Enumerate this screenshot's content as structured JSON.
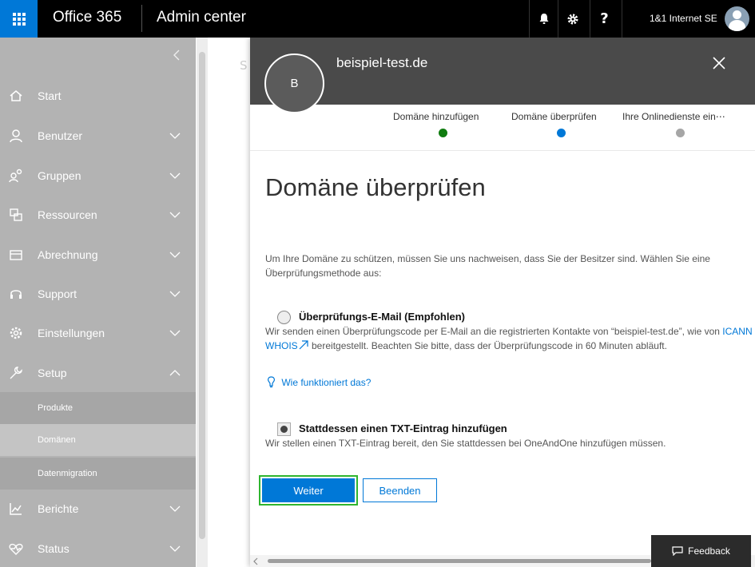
{
  "topbar": {
    "brand": "Office 365",
    "app_title": "Admin center",
    "user_name": "1&1 Internet SE",
    "help_label": "?"
  },
  "sidebar": {
    "items": [
      {
        "label": "Start",
        "icon": "home-icon"
      },
      {
        "label": "Benutzer",
        "icon": "user-icon"
      },
      {
        "label": "Gruppen",
        "icon": "group-icon"
      },
      {
        "label": "Ressourcen",
        "icon": "resources-icon"
      },
      {
        "label": "Abrechnung",
        "icon": "billing-icon"
      },
      {
        "label": "Support",
        "icon": "headset-icon"
      },
      {
        "label": "Einstellungen",
        "icon": "gear-icon"
      },
      {
        "label": "Setup",
        "icon": "wrench-icon"
      },
      {
        "label": "Berichte",
        "icon": "chart-icon"
      },
      {
        "label": "Status",
        "icon": "heart-icon"
      }
    ],
    "setup_sub": [
      {
        "label": "Produkte"
      },
      {
        "label": "Domänen",
        "active": true
      },
      {
        "label": "Datenmigration"
      }
    ]
  },
  "background": {
    "ghost_text": "S"
  },
  "panel": {
    "avatar_letter": "B",
    "title": "beispiel-test.de",
    "steps": [
      {
        "label": "Domäne hinzufügen",
        "state": "done"
      },
      {
        "label": "Domäne überprüfen",
        "state": "current"
      },
      {
        "label": "Ihre Onlinedienste ein⋯",
        "state": "future"
      }
    ],
    "heading": "Domäne überprüfen",
    "intro": "Um Ihre Domäne zu schützen, müssen Sie uns nachweisen, dass Sie der Besitzer sind. Wählen Sie eine Überprüfungsmethode aus:",
    "option_email": {
      "title": "Überprüfungs-E-Mail (Empfohlen)",
      "desc_part1": "Wir senden einen Überprüfungscode per E-Mail an die registrierten Kontakte von “beispiel-test.de”, wie von ",
      "link": "ICANN WHOIS",
      "desc_part2": " bereitgestellt. Beachten Sie bitte, dass der Überprüfungscode in 60 Minuten abläuft.",
      "selected": false
    },
    "help_link": "Wie funktioniert das?",
    "option_txt": {
      "title": "Stattdessen einen TXT-Eintrag hinzufügen",
      "desc": "Wir stellen einen TXT-Eintrag bereit, den Sie stattdessen bei OneAndOne hinzufügen müssen.",
      "selected": true
    },
    "buttons": {
      "next": "Weiter",
      "cancel": "Beenden"
    }
  },
  "feedback": {
    "label": "Feedback"
  },
  "colors": {
    "accent": "#0078d7",
    "done": "#107c10",
    "future": "#a6a6a6",
    "focus": "#2fb52f"
  }
}
